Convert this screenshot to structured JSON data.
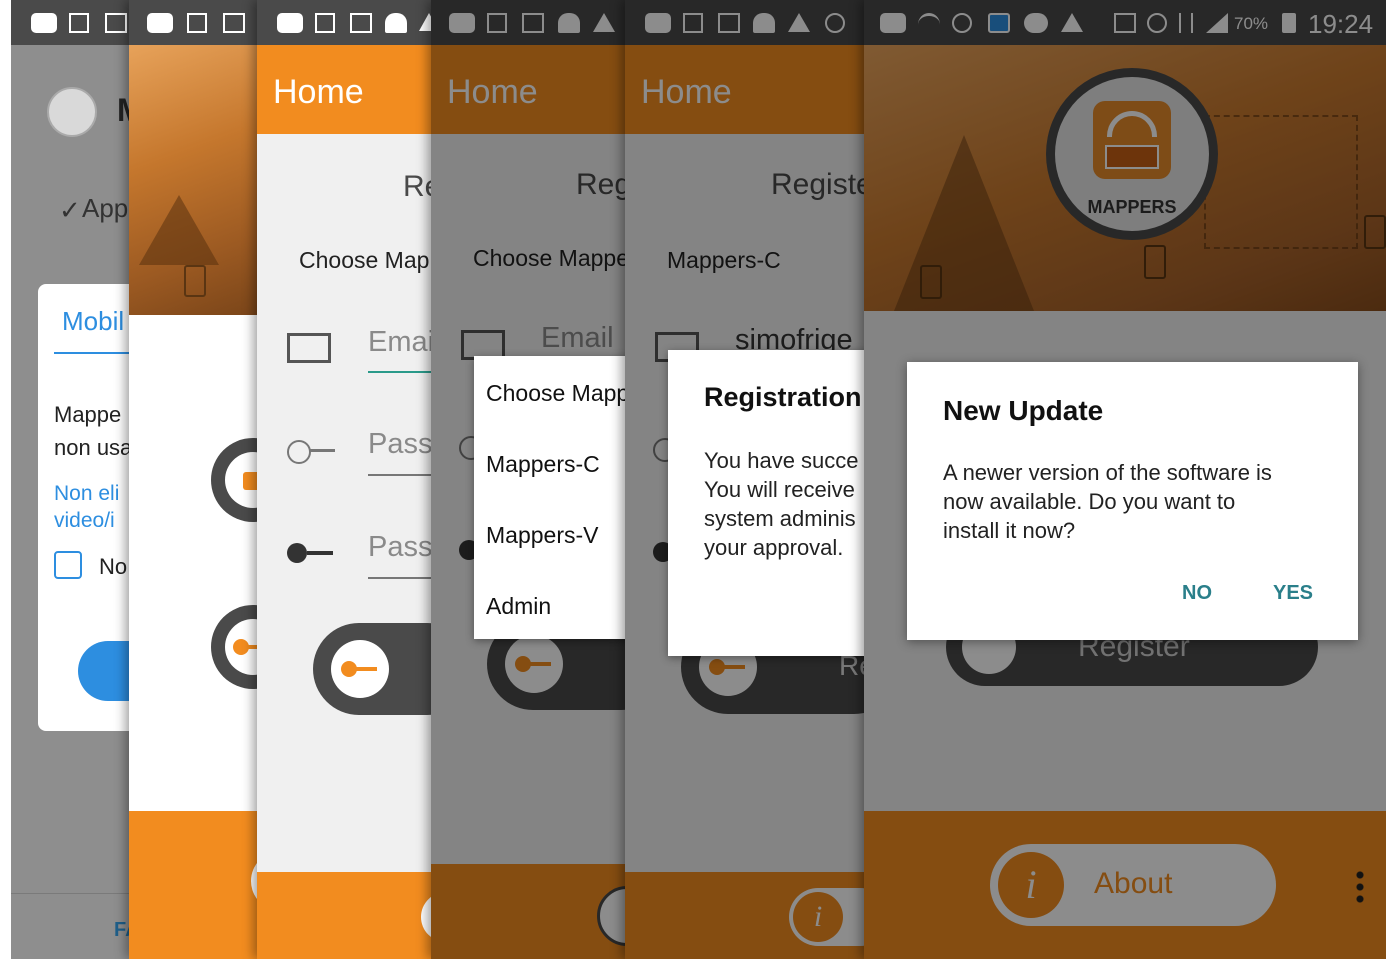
{
  "status_bar": {
    "battery": "70%",
    "time": "19:24"
  },
  "panel1": {
    "title_initial": "M",
    "section": "App",
    "dialog": {
      "title": "Mobil",
      "body_line1": "Mappe",
      "body_line2": "non usa",
      "link_line1": "Non eli",
      "link_line2": "video/i",
      "checkbox_label": "No"
    },
    "footer": "FA"
  },
  "panel3": {
    "header": "Home",
    "heading": "Re",
    "chooser": "Choose Map",
    "email_placeholder": "Emai",
    "password_placeholder": "Pass",
    "confirm_placeholder": "Pass"
  },
  "panel4": {
    "header": "Home",
    "heading": "Reg",
    "chooser": "Choose Mappe",
    "email_placeholder": "Email",
    "menu": {
      "title": "Choose Mapp",
      "items": [
        "Mappers-C",
        "Mappers-V",
        "Admin"
      ]
    }
  },
  "panel5": {
    "header": "Home",
    "heading": "Registe",
    "selected": "Mappers-C",
    "email_value": "simofrige",
    "dialog": {
      "title": "Registration",
      "body": [
        "You have succe",
        "You will receive",
        "system adminis",
        "your approval."
      ]
    },
    "button_fragment": "Re"
  },
  "panel6": {
    "logo_text": "MAPPERS",
    "dialog": {
      "title": "New Update",
      "body": [
        "A newer version of the software is",
        "now available. Do you want to",
        "install it now?"
      ],
      "no": "NO",
      "yes": "YES"
    },
    "register_label": "Register",
    "about_label": "About",
    "about_icon_text": "i"
  },
  "colors": {
    "orange": "#f28c1f",
    "dark": "#4a4a4a",
    "teal": "#2a7f8a"
  }
}
